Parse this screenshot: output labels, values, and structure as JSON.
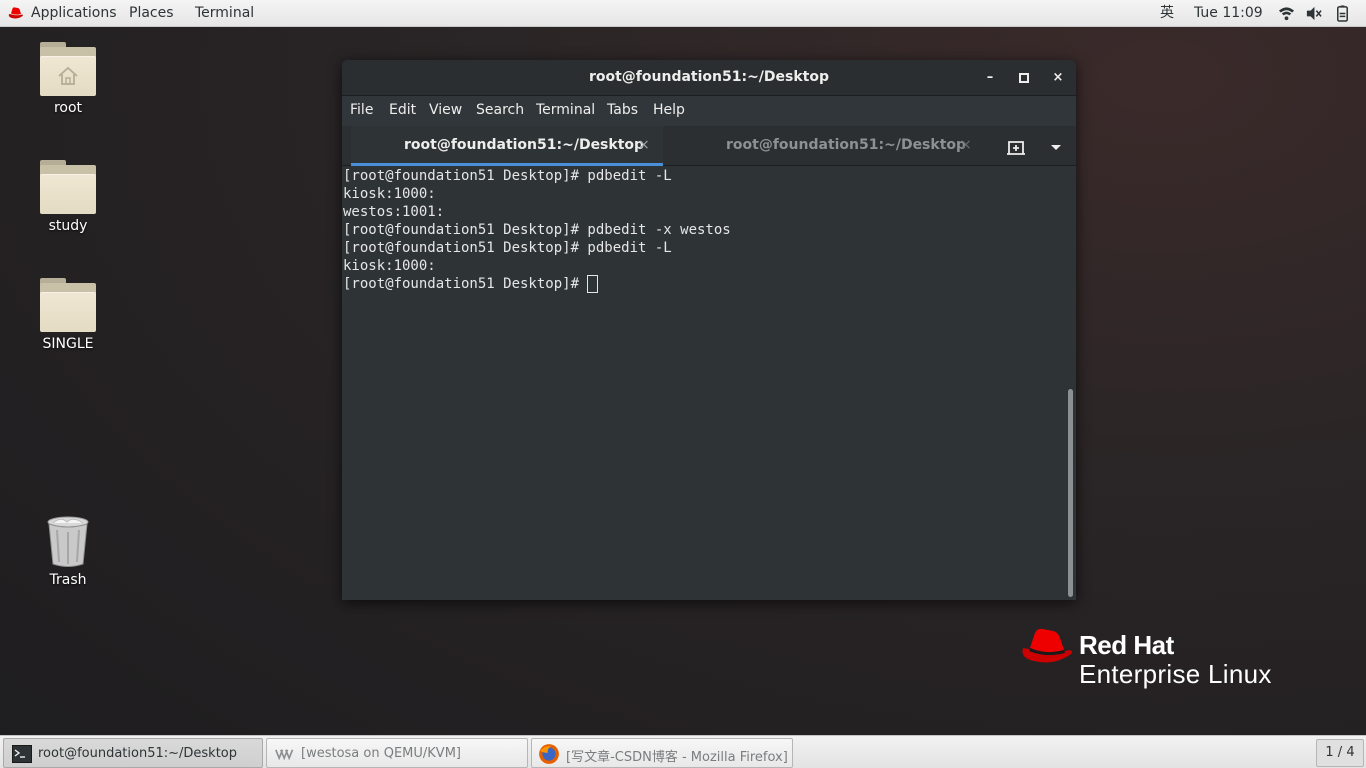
{
  "topbar": {
    "applications": "Applications",
    "places": "Places",
    "terminal": "Terminal",
    "input_method": "英",
    "clock": "Tue 11:09"
  },
  "desktop": {
    "icons": [
      {
        "label": "root"
      },
      {
        "label": "study"
      },
      {
        "label": "SINGLE"
      },
      {
        "label": "Trash"
      }
    ]
  },
  "terminal": {
    "title": "root@foundation51:~/Desktop",
    "window_buttons": {
      "minimize": "–",
      "maximize": "□",
      "close": "×"
    },
    "menu": [
      "File",
      "Edit",
      "View",
      "Search",
      "Terminal",
      "Tabs",
      "Help"
    ],
    "tabs": [
      {
        "label": "root@foundation51:~/Desktop",
        "close": "×",
        "active": true
      },
      {
        "label": "root@foundation51:~/Desktop",
        "close": "×",
        "active": false
      }
    ],
    "lines": [
      "[root@foundation51 Desktop]# pdbedit -L",
      "kiosk:1000:",
      "westos:1001:",
      "[root@foundation51 Desktop]# pdbedit -x westos",
      "[root@foundation51 Desktop]# pdbedit -L",
      "kiosk:1000:",
      "[root@foundation51 Desktop]# "
    ]
  },
  "branding": {
    "line1": "Red Hat",
    "line2": "Enterprise Linux"
  },
  "taskbar": {
    "tasks": [
      {
        "label": "root@foundation51:~/Desktop",
        "icon": "terminal-icon"
      },
      {
        "label": "[westosa on QEMU/KVM]",
        "icon": "virt-manager-icon"
      },
      {
        "label": "[写文章-CSDN博客 - Mozilla Firefox]",
        "icon": "firefox-icon"
      }
    ],
    "workspace": "1 / 4"
  },
  "colors": {
    "accent": "#4a90d9",
    "redhat_red": "#ee0000",
    "terminal_bg": "#2e3436"
  }
}
